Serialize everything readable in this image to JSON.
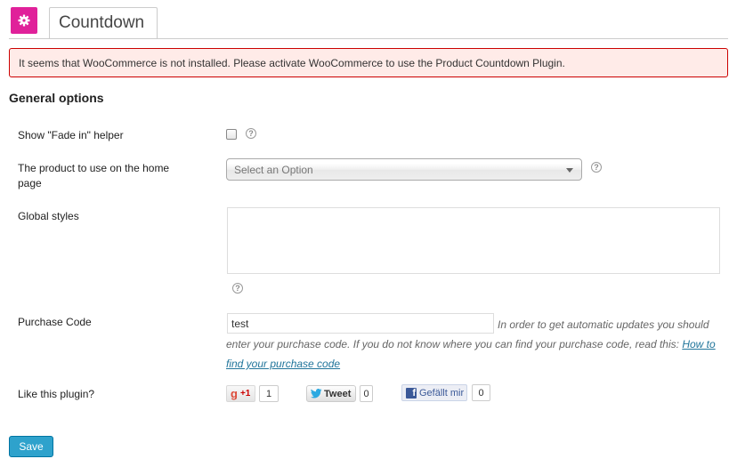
{
  "header": {
    "tab_label": "Countdown",
    "plugin_icon": "gear-icon"
  },
  "notice": {
    "text": "It seems that WooCommerce is not installed. Please activate WooCommerce to use the Product Countdown Plugin."
  },
  "section": {
    "title": "General options"
  },
  "fields": {
    "fade_in": {
      "label": "Show \"Fade in\" helper",
      "checked": false
    },
    "product": {
      "label": "The product to use on the home page",
      "selected": "Select an Option"
    },
    "styles": {
      "label": "Global styles",
      "value": ""
    },
    "purchase": {
      "label": "Purchase Code",
      "value": "test",
      "description": "In order to get automatic updates you should enter your purchase code. If you do not know where you can find your purchase code, read this: ",
      "link_text": "How to find your purchase code"
    },
    "like": {
      "label": "Like this plugin?",
      "gplus": {
        "icon": "g",
        "label": "+1",
        "count": "1"
      },
      "twitter": {
        "label": "Tweet",
        "count": "0"
      },
      "facebook": {
        "label": "Gefällt mir",
        "count": "0"
      }
    }
  },
  "help_glyph": "?",
  "footer": {
    "save_label": "Save"
  },
  "colors": {
    "accent": "#e0219a",
    "notice_bg": "#ffebe8",
    "notice_border": "#cc0000",
    "link": "#21759b",
    "save_button": "#2ea2cc"
  }
}
